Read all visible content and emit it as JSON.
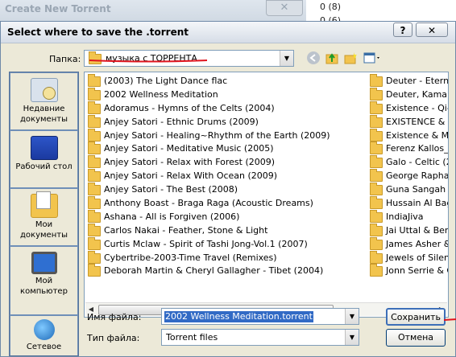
{
  "background_window": {
    "title": "Create New Torrent",
    "close_glyph": "✕",
    "counts": [
      "0 (8)",
      "0 (6)"
    ]
  },
  "dialog": {
    "title": "Select where to save the .torrent",
    "help_glyph": "?",
    "close_glyph": "✕",
    "folder_label": "Папка:",
    "folder_value": "музыка с ТОРРЕНТА",
    "places": [
      {
        "label": "Недавние документы",
        "icon": "recent-docs-icon"
      },
      {
        "label": "Рабочий стол",
        "icon": "desktop-icon"
      },
      {
        "label": "Мои документы",
        "icon": "my-documents-icon"
      },
      {
        "label": "Мой компьютер",
        "icon": "my-computer-icon"
      },
      {
        "label": "Сетевое",
        "icon": "network-icon"
      }
    ],
    "files_col1": [
      "(2003) The Light Dance flac",
      "2002 Wellness Meditation",
      "Adoramus - Hymns of the Celts (2004)",
      "Anjey Satori - Ethnic Drums (2009)",
      "Anjey Satori - Healing~Rhythm of the Earth (2009)",
      "Anjey Satori - Meditative Music (2005)",
      "Anjey Satori - Relax with Forest (2009)",
      "Anjey Satori - Relax With Ocean (2009)",
      "Anjey Satori - The Best (2008)",
      "Anthony Boast - Braga Raga (Acoustic Dreams)",
      "Ashana - All is Forgiven (2006)",
      "Carlos Nakai - Feather, Stone & Light",
      "Curtis Mclaw - Spirit of Tashi Jong-Vol.1 (2007)",
      "Cybertribe-2003-Time Travel (Remixes)",
      "Deborah Martin & Cheryl Gallagher - Tibet (2004)"
    ],
    "files_col2": [
      "Deuter - Eternit",
      "Deuter, Kamal &",
      "Existence - Qi-C",
      "EXISTENCE & M",
      "Existence & Mar",
      "Ferenz Kallos_M",
      "Galo - Celtic (20",
      "George Raphae",
      "Guna Sangah - I",
      "Hussain Al Baga",
      "IndiaJiva",
      "Jai Uttal & Ben L",
      "James Asher & A",
      "Jewels of Silenc",
      "Jonn Serrie & G"
    ],
    "filename_label": "Имя файла:",
    "filename_value": "2002 Wellness Meditation.torrent",
    "filetype_label": "Тип файла:",
    "filetype_value": "Torrent files",
    "save_label": "Сохранить",
    "cancel_label": "Отмена"
  },
  "colors": {
    "annotation_red": "#e0141e",
    "selection_blue": "#316ac5"
  }
}
